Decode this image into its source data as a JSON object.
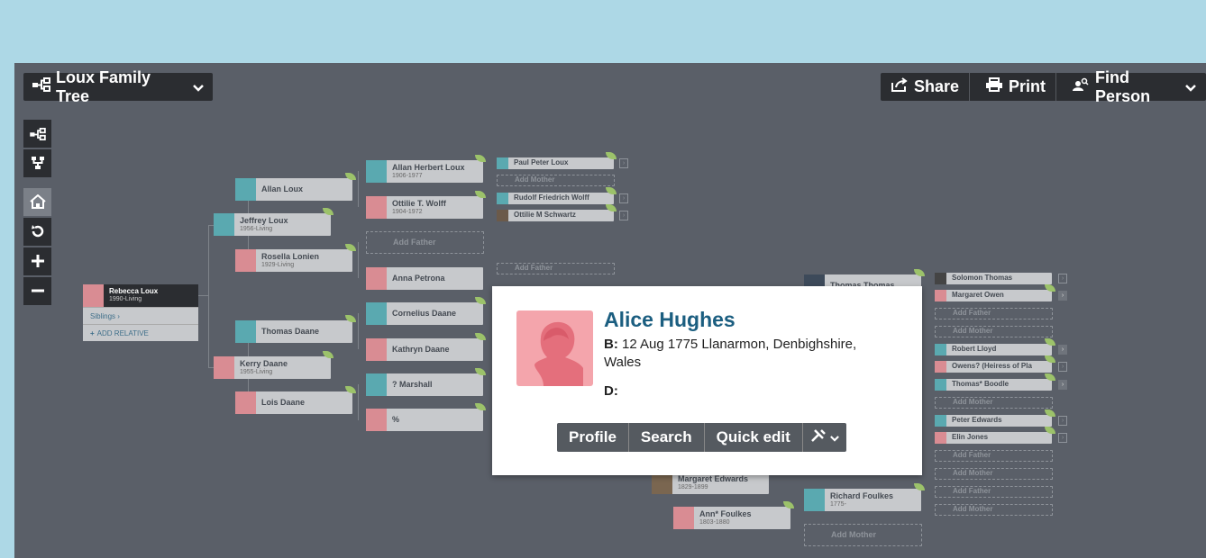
{
  "toolbar": {
    "tree_label": "Loux Family Tree",
    "share_label": "Share",
    "print_label": "Print",
    "find_label": "Find Person"
  },
  "root_person": {
    "name": "Rebecca Loux",
    "dates": "1990-Living",
    "siblings_label": "Siblings ›",
    "add_relative_label": "ADD RELATIVE"
  },
  "gen1": [
    {
      "name": "Jeffrey Loux",
      "dates": "1956-Living"
    },
    {
      "name": "Kerry Daane",
      "dates": "1955-Living"
    }
  ],
  "gen2": [
    {
      "name": "Allan Loux",
      "dates": ""
    },
    {
      "name": "Rosella Lonien",
      "dates": "1929-Living"
    },
    {
      "name": "Thomas Daane",
      "dates": ""
    },
    {
      "name": "Lois Daane",
      "dates": ""
    }
  ],
  "gen3": [
    {
      "name": "Allan Herbert Loux",
      "dates": "1906-1977"
    },
    {
      "name": "Ottilie T. Wolff",
      "dates": "1904-1972"
    },
    {
      "name": "Add Father",
      "dates": ""
    },
    {
      "name": "Anna Petrona",
      "dates": ""
    },
    {
      "name": "Cornelius Daane",
      "dates": ""
    },
    {
      "name": "Kathryn Daane",
      "dates": ""
    },
    {
      "name": "? Marshall",
      "dates": ""
    },
    {
      "name": "%",
      "dates": ""
    }
  ],
  "gen4_left": [
    {
      "name": "Paul Peter Loux"
    },
    {
      "name": "Add Mother"
    },
    {
      "name": "Rudolf Friedrich Wolff"
    },
    {
      "name": "Ottilie M Schwartz"
    },
    {
      "name": "Add Father"
    }
  ],
  "right_tree": {
    "thomas": "Thomas Thomas",
    "margaret_edwards": {
      "name": "Margaret Edwards",
      "dates": "1829-1899"
    },
    "ann_foulkes": {
      "name": "Ann* Foulkes",
      "dates": "1803-1880"
    },
    "richard_foulkes": {
      "name": "Richard Foulkes",
      "dates": "1775-"
    },
    "add_mother": "Add Mother",
    "col": [
      "Solomon Thomas",
      "Margaret Owen",
      "Add Father",
      "Add Mother",
      "Robert Lloyd",
      "Owens? (Heiress of Pla",
      "Thomas* Boodle",
      "Add Mother",
      "Peter Edwards",
      "Elin Jones",
      "Add Father",
      "Add Mother",
      "Add Father",
      "Add Mother"
    ]
  },
  "popup": {
    "name": "Alice Hughes",
    "birth_label": "B:",
    "birth_value": "12 Aug 1775 Llanarmon, Denbighshire, Wales",
    "death_label": "D:",
    "death_value": "",
    "actions": [
      "Profile",
      "Search",
      "Quick edit"
    ]
  },
  "icons": {
    "tree": "tree-icon",
    "share": "share-icon",
    "print": "print-icon",
    "find": "find-person-icon"
  }
}
